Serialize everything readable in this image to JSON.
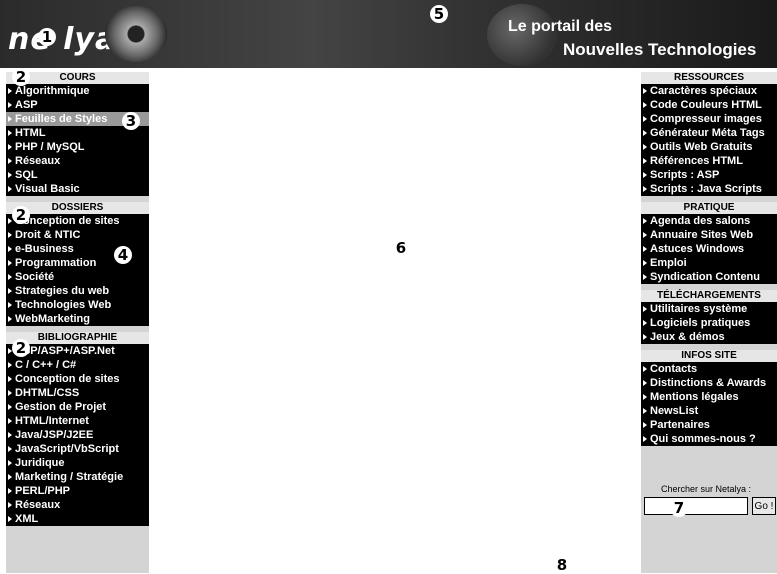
{
  "banner": {
    "logo": "ne lya",
    "tagline_line1": "Le portail des",
    "tagline_line2": "Nouvelles Technologies"
  },
  "left": {
    "cours": {
      "title": "COURS",
      "items": [
        "Algorithmique",
        "ASP",
        "Feuilles de Styles",
        "HTML",
        "PHP / MySQL",
        "Réseaux",
        "SQL",
        "Visual Basic"
      ]
    },
    "dossiers": {
      "title": "DOSSIERS",
      "items": [
        "Conception de sites",
        "Droit & NTIC",
        "e-Business",
        "Programmation",
        "Société",
        "Strategies du web",
        "Technologies Web",
        "WebMarketing"
      ]
    },
    "biblio": {
      "title": "BIBLIOGRAPHIE",
      "items": [
        "ASP/ASP+/ASP.Net",
        "C / C++ / C#",
        "Conception de sites",
        "DHTML/CSS",
        "Gestion de Projet",
        "HTML/Internet",
        "Java/JSP/J2EE",
        "JavaScript/VbScript",
        "Juridique",
        "Marketing / Stratégie",
        "PERL/PHP",
        "Réseaux",
        "XML"
      ]
    }
  },
  "right": {
    "ressources": {
      "title": "RESSOURCES",
      "items": [
        "Caractères spéciaux",
        "Code Couleurs HTML",
        "Compresseur images",
        "Générateur Méta Tags",
        "Outils Web Gratuits",
        "Références HTML",
        "Scripts : ASP",
        "Scripts : Java Scripts"
      ]
    },
    "pratique": {
      "title": "PRATIQUE",
      "items": [
        "Agenda des salons",
        "Annuaire Sites Web",
        "Astuces Windows",
        "Emploi",
        "Syndication Contenu"
      ]
    },
    "telechargements": {
      "title": "TÉLÉCHARGEMENTS",
      "items": [
        "Utilitaires système",
        "Logiciels pratiques",
        "Jeux & démos"
      ]
    },
    "infos": {
      "title": "INFOS SITE",
      "items": [
        "Contacts",
        "Distinctions & Awards",
        "Mentions légales",
        "NewsList",
        "Partenaires",
        "Qui sommes-nous ?"
      ]
    }
  },
  "search": {
    "label": "Chercher sur Netalya :",
    "value": "",
    "button": "Go !"
  },
  "markers": [
    "1",
    "2",
    "2",
    "2",
    "3",
    "4",
    "5",
    "6",
    "7",
    "8"
  ]
}
